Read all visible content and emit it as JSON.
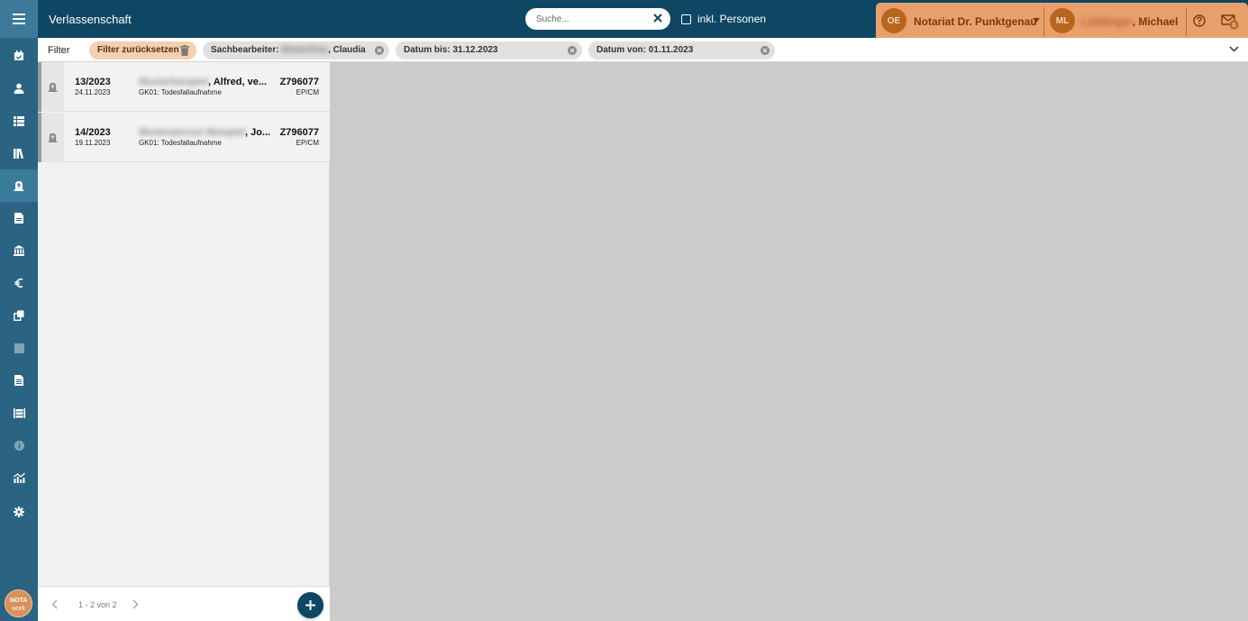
{
  "header": {
    "title": "Verlassenschaft",
    "search_placeholder": "Suche...",
    "incl_persons_label": "inkl. Personen",
    "org_initials": "OE",
    "org_name": "Notariat Dr. Punktgenau",
    "user_initials": "ML",
    "user_name_hidden": "Lieblinger",
    "user_name_visible": ", Michael",
    "mail_badge": "0"
  },
  "filters": {
    "label": "Filter",
    "reset_label": "Filter zurücksetzen",
    "chips": [
      {
        "prefix": "Sachbearbeiter: ",
        "hidden": "Musterfrau",
        "suffix": ", Claudia"
      },
      {
        "text": "Datum bis: 31.12.2023"
      },
      {
        "text": "Datum von: 01.11.2023"
      }
    ]
  },
  "list": {
    "rows": [
      {
        "number": "13/2023",
        "date": "24.11.2023",
        "name_hidden": "Musterbeispiel",
        "name_visible": ", Alfred, ve...",
        "kind": "GK01: Todesfallaufnahme",
        "ref": "Z796077",
        "initials": "EP/CM"
      },
      {
        "number": "14/2023",
        "date": "19.11.2023",
        "name_hidden": "Musterperson Beispiel",
        "name_visible": ", Jo...",
        "kind": "GK01: Todesfallaufnahme",
        "ref": "Z796077",
        "initials": "EP/CM"
      }
    ],
    "pager_text": "1 - 2 von 2"
  },
  "logo": {
    "line1": "NOTA",
    "line2": "work"
  },
  "colors": {
    "header": "#0e4663",
    "sidebar": "#2a6482",
    "accent": "#e8a06d"
  }
}
